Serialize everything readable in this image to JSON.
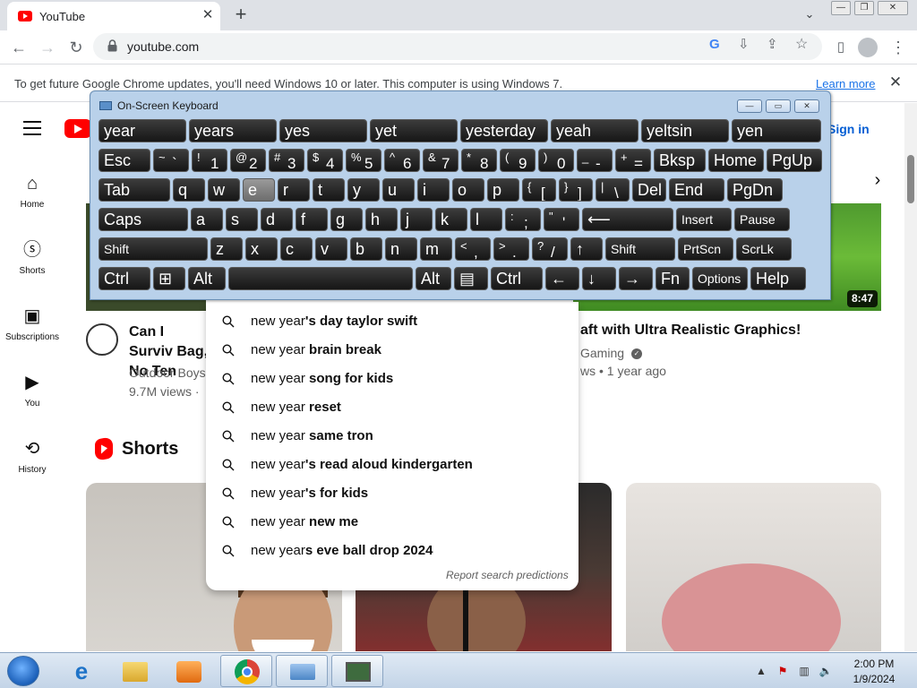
{
  "browser": {
    "tab_title": "YouTube",
    "url": "youtube.com",
    "infobar_text": "To get future Google Chrome updates, you'll need Windows 10 or later. This computer is using Windows 7.",
    "infobar_link": "Learn more"
  },
  "youtube": {
    "signin": "Sign in",
    "sidebar": [
      {
        "label": "Home",
        "icon": "home-icon"
      },
      {
        "label": "Shorts",
        "icon": "shorts-icon"
      },
      {
        "label": "Subscriptions",
        "icon": "subscriptions-icon"
      },
      {
        "label": "You",
        "icon": "you-icon"
      },
      {
        "label": "History",
        "icon": "history-icon"
      }
    ],
    "video1": {
      "title": "Can I Surviv Bag, No Ten",
      "channel": "Outdoor Boys",
      "views": "9.7M views ·"
    },
    "video2": {
      "title": "aft with Ultra Realistic Graphics!",
      "channel": "Gaming",
      "meta": "ws • 1 year ago",
      "duration": "8:47"
    },
    "shorts_heading": "Shorts"
  },
  "suggestions": {
    "items": [
      {
        "bold": "new year's day taylor swift",
        "typed": "new year"
      },
      {
        "bold": "new year brain break",
        "typed": "new year"
      },
      {
        "bold": "new year song for kids",
        "typed": "new year"
      },
      {
        "bold": "new year reset",
        "typed": "new year"
      },
      {
        "bold": "new year same tron",
        "typed": "new year"
      },
      {
        "bold": "new year's read aloud kindergarten",
        "typed": "new year"
      },
      {
        "bold": "new year's for kids",
        "typed": "new year"
      },
      {
        "bold": "new year new me",
        "typed": "new year"
      },
      {
        "bold": "new years eve ball drop 2024",
        "typed": "new year"
      }
    ],
    "report": "Report search predictions"
  },
  "osk": {
    "title": "On-Screen Keyboard",
    "predictions": [
      "year",
      "years",
      "yes",
      "yet",
      "yesterday",
      "yeah",
      "yeltsin",
      "yen"
    ],
    "row1": [
      {
        "label": "Esc"
      },
      {
        "up": "~",
        "dn": "`"
      },
      {
        "up": "!",
        "dn": "1"
      },
      {
        "up": "@",
        "dn": "2"
      },
      {
        "up": "#",
        "dn": "3"
      },
      {
        "up": "$",
        "dn": "4"
      },
      {
        "up": "%",
        "dn": "5"
      },
      {
        "up": "^",
        "dn": "6"
      },
      {
        "up": "&",
        "dn": "7"
      },
      {
        "up": "*",
        "dn": "8"
      },
      {
        "up": "(",
        "dn": "9"
      },
      {
        "up": ")",
        "dn": "0"
      },
      {
        "up": "_",
        "dn": "-"
      },
      {
        "up": "+",
        "dn": "="
      },
      {
        "label": "Bksp"
      },
      {
        "label": "Home"
      },
      {
        "label": "PgUp"
      }
    ],
    "row2": [
      {
        "label": "Tab"
      },
      {
        "label": "q"
      },
      {
        "label": "w"
      },
      {
        "label": "e"
      },
      {
        "label": "r"
      },
      {
        "label": "t"
      },
      {
        "label": "y"
      },
      {
        "label": "u"
      },
      {
        "label": "i"
      },
      {
        "label": "o"
      },
      {
        "label": "p"
      },
      {
        "up": "{",
        "dn": "["
      },
      {
        "up": "}",
        "dn": "]"
      },
      {
        "up": "|",
        "dn": "\\"
      },
      {
        "label": "Del"
      },
      {
        "label": "End"
      },
      {
        "label": "PgDn"
      }
    ],
    "row3": [
      {
        "label": "Caps"
      },
      {
        "label": "a"
      },
      {
        "label": "s"
      },
      {
        "label": "d"
      },
      {
        "label": "f"
      },
      {
        "label": "g"
      },
      {
        "label": "h"
      },
      {
        "label": "j"
      },
      {
        "label": "k"
      },
      {
        "label": "l"
      },
      {
        "up": ":",
        "dn": ";"
      },
      {
        "up": "\"",
        "dn": "'"
      },
      {
        "label": "⟵"
      },
      {
        "label": "Insert"
      },
      {
        "label": "Pause"
      }
    ],
    "row4": [
      {
        "label": "Shift"
      },
      {
        "label": "z"
      },
      {
        "label": "x"
      },
      {
        "label": "c"
      },
      {
        "label": "v"
      },
      {
        "label": "b"
      },
      {
        "label": "n"
      },
      {
        "label": "m"
      },
      {
        "up": "<",
        "dn": ","
      },
      {
        "up": ">",
        "dn": "."
      },
      {
        "up": "?",
        "dn": "/"
      },
      {
        "label": "↑"
      },
      {
        "label": "Shift"
      },
      {
        "label": "PrtScn"
      },
      {
        "label": "ScrLk"
      }
    ],
    "row5": [
      {
        "label": "Ctrl"
      },
      {
        "label": "⊞"
      },
      {
        "label": "Alt"
      },
      {
        "label": ""
      },
      {
        "label": "Alt"
      },
      {
        "label": "▤"
      },
      {
        "label": "Ctrl"
      },
      {
        "label": "←"
      },
      {
        "label": "↓"
      },
      {
        "label": "→"
      },
      {
        "label": "Fn"
      },
      {
        "label": "Options"
      },
      {
        "label": "Help"
      }
    ]
  },
  "taskbar": {
    "time": "2:00 PM",
    "date": "1/9/2024"
  },
  "colors": {
    "youtube_red": "#ff0000",
    "link_blue": "#065fd4",
    "osk_frame": "#b9d1ea"
  }
}
